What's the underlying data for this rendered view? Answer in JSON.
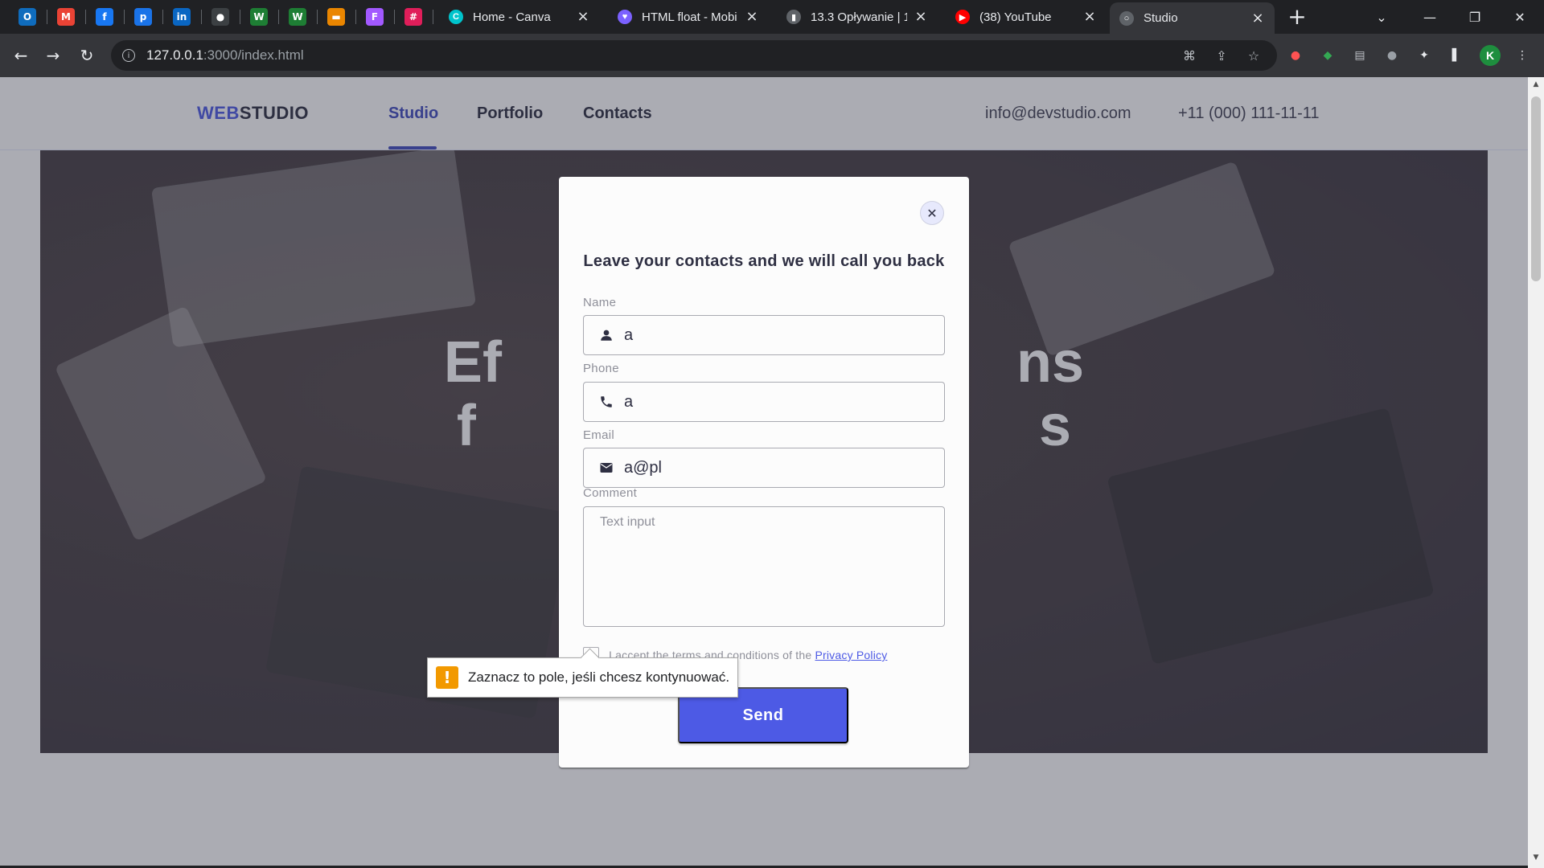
{
  "browser": {
    "pinned_tabs": [
      {
        "icon": "outlook-icon",
        "glyph": "O",
        "color": "#0f6cbd"
      },
      {
        "icon": "gmail-icon",
        "glyph": "M",
        "color": "#ea4335"
      },
      {
        "icon": "facebook-icon",
        "glyph": "f",
        "color": "#1877f2"
      },
      {
        "icon": "pinterest-icon",
        "glyph": "p",
        "color": "#1a73e8"
      },
      {
        "icon": "linkedin-icon",
        "glyph": "in",
        "color": "#0a66c2"
      },
      {
        "icon": "github-icon",
        "glyph": "●",
        "color": "#3c4043"
      },
      {
        "icon": "webflow-icon",
        "glyph": "W",
        "color": "#1e7e34"
      },
      {
        "icon": "webflow-icon-2",
        "glyph": "W",
        "color": "#1e7e34"
      },
      {
        "icon": "slides-icon",
        "glyph": "▬",
        "color": "#ea8600"
      },
      {
        "icon": "figma-icon",
        "glyph": "F",
        "color": "#a259ff"
      },
      {
        "icon": "slack-icon",
        "glyph": "#",
        "color": "#e01e5a"
      }
    ],
    "tabs": [
      {
        "title": "Home - Canva",
        "icon": "canva-icon",
        "glyph": "C",
        "color": "#00c4cc"
      },
      {
        "title": "HTML float - Mobi",
        "icon": "heart-icon",
        "glyph": "♥",
        "color": "#7b61ff"
      },
      {
        "title": "13.3 Opływanie | 1",
        "icon": "bookmark-icon",
        "glyph": "▮",
        "color": "#5f6368"
      },
      {
        "title": "(38) YouTube",
        "icon": "youtube-icon",
        "glyph": "▶",
        "color": "#ff0000"
      },
      {
        "title": "Studio",
        "icon": "globe-icon",
        "glyph": "○",
        "color": "#5f6368",
        "active": true
      }
    ],
    "url_host": "127.0.0.1",
    "url_path": ":3000/index.html",
    "profile_initial": "K"
  },
  "site": {
    "logo_accent": "WEB",
    "logo_main": "STUDIO",
    "nav": [
      "Studio",
      "Portfolio",
      "Contacts"
    ],
    "email": "info@devstudio.com",
    "phone": "+11 (000) 111-11-11",
    "hero_line1": "Ef                                ns",
    "hero_line2": "f                                   s"
  },
  "modal": {
    "title": "Leave your contacts and we will call you back",
    "name_label": "Name",
    "name_value": "a",
    "phone_label": "Phone",
    "phone_value": "a",
    "email_label": "Email",
    "email_value": "a@pl",
    "comment_label": "Comment",
    "comment_placeholder": "Text input",
    "terms_text": "I accept the terms and conditions of the ",
    "terms_link": "Privacy Policy",
    "send_label": "Send"
  },
  "validation": {
    "message": "Zaznacz to pole, jeśli chcesz kontynuować.",
    "icon_glyph": "!"
  },
  "colors": {
    "accent": "#4d5ae5",
    "nav_active": "#404bbf",
    "warning": "#f29900"
  }
}
